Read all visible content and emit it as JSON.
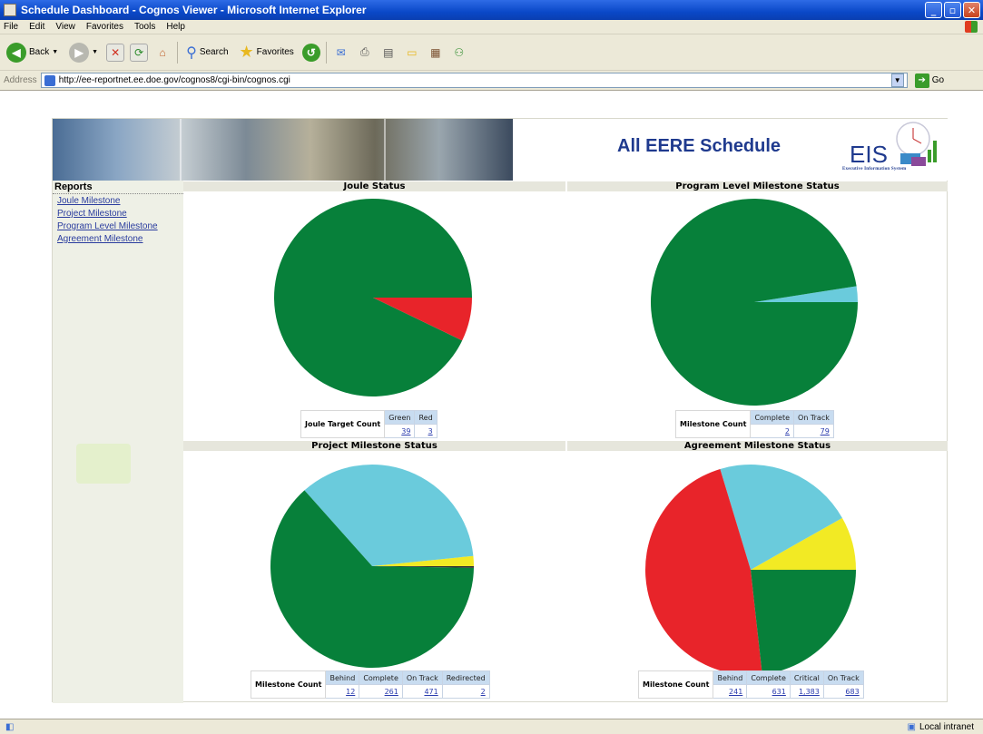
{
  "window": {
    "title": "Schedule Dashboard - Cognos Viewer - Microsoft Internet Explorer"
  },
  "menu": [
    "File",
    "Edit",
    "View",
    "Favorites",
    "Tools",
    "Help"
  ],
  "toolbar": {
    "back": "Back",
    "search": "Search",
    "favorites": "Favorites"
  },
  "address": {
    "label": "Address",
    "url": "http://ee-reportnet.ee.doe.gov/cognos8/cgi-bin/cognos.cgi",
    "go": "Go"
  },
  "status": {
    "zone": "Local intranet"
  },
  "banner": {
    "title": "All EERE  Schedule",
    "logo_text": "EIS",
    "logo_sub": "Executive Information System"
  },
  "sidebar": {
    "heading": "Reports",
    "links": [
      "Joule Milestone",
      "Project Milestone",
      "Program Level Milestone",
      "Agreement Milestone"
    ]
  },
  "colors": {
    "green": "#07803a",
    "red": "#e8242a",
    "light_blue": "#6acbdc",
    "yellow": "#f2ea24",
    "dark": "#333333"
  },
  "panels": [
    {
      "title": "Joule Status",
      "table": {
        "header": "Joule Target Count",
        "columns": [
          "Green",
          "Red"
        ],
        "values": [
          "39",
          "3"
        ]
      }
    },
    {
      "title": "Program Level Milestone Status",
      "table": {
        "header": "Milestone Count",
        "columns": [
          "Complete",
          "On Track"
        ],
        "values": [
          "2",
          "79"
        ]
      }
    },
    {
      "title": "Project Milestone Status",
      "table": {
        "header": "Milestone Count",
        "columns": [
          "Behind",
          "Complete",
          "On Track",
          "Redirected"
        ],
        "values": [
          "12",
          "261",
          "471",
          "2"
        ]
      }
    },
    {
      "title": "Agreement Milestone Status",
      "table": {
        "header": "Milestone Count",
        "columns": [
          "Behind",
          "Complete",
          "Critical",
          "On Track"
        ],
        "values": [
          "241",
          "631",
          "1,383",
          "683"
        ]
      }
    }
  ],
  "chart_data": [
    {
      "type": "pie",
      "title": "Joule Status",
      "slices": [
        {
          "label": "Green",
          "value": 39,
          "color": "#07803a"
        },
        {
          "label": "Red",
          "value": 3,
          "color": "#e8242a"
        }
      ]
    },
    {
      "type": "pie",
      "title": "Program Level Milestone Status",
      "slices": [
        {
          "label": "Complete",
          "value": 2,
          "color": "#6acbdc"
        },
        {
          "label": "On Track",
          "value": 79,
          "color": "#07803a"
        }
      ]
    },
    {
      "type": "pie",
      "title": "Project Milestone Status",
      "slices": [
        {
          "label": "Behind",
          "value": 12,
          "color": "#f2ea24"
        },
        {
          "label": "Complete",
          "value": 261,
          "color": "#6acbdc"
        },
        {
          "label": "On Track",
          "value": 471,
          "color": "#07803a"
        },
        {
          "label": "Redirected",
          "value": 2,
          "color": "#333333"
        }
      ]
    },
    {
      "type": "pie",
      "title": "Agreement Milestone Status",
      "slices": [
        {
          "label": "Behind",
          "value": 241,
          "color": "#f2ea24"
        },
        {
          "label": "Complete",
          "value": 631,
          "color": "#6acbdc"
        },
        {
          "label": "Critical",
          "value": 1383,
          "color": "#e8242a"
        },
        {
          "label": "On Track",
          "value": 683,
          "color": "#07803a"
        }
      ]
    }
  ]
}
